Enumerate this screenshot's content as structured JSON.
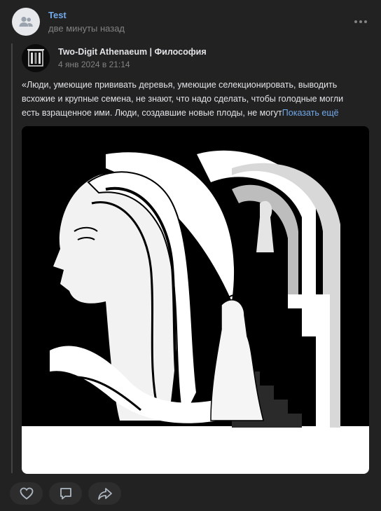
{
  "post": {
    "author": "Test",
    "time": "две минуты назад"
  },
  "repost": {
    "source_name": "Two-Digit Athenaeum | Философия",
    "date": "4 янв 2024 в 21:14",
    "text_lines": [
      "«Люди, умеющие прививать деревья, умеющие селекционировать, выводить",
      "всхожие и крупные семена, не знают, что надо сделать, чтобы голодные могли",
      "есть взращенное ими. Люди, создавшие новые плоды, не могут"
    ],
    "show_more": "Показать ещё"
  },
  "icons": {
    "avatar": "group-icon",
    "more": "more-dots-icon",
    "like": "heart-icon",
    "comment": "comment-icon",
    "share": "share-icon"
  },
  "colors": {
    "background": "#222222",
    "link": "#71aaeb",
    "muted": "#828282",
    "text": "#e1e3e6"
  }
}
